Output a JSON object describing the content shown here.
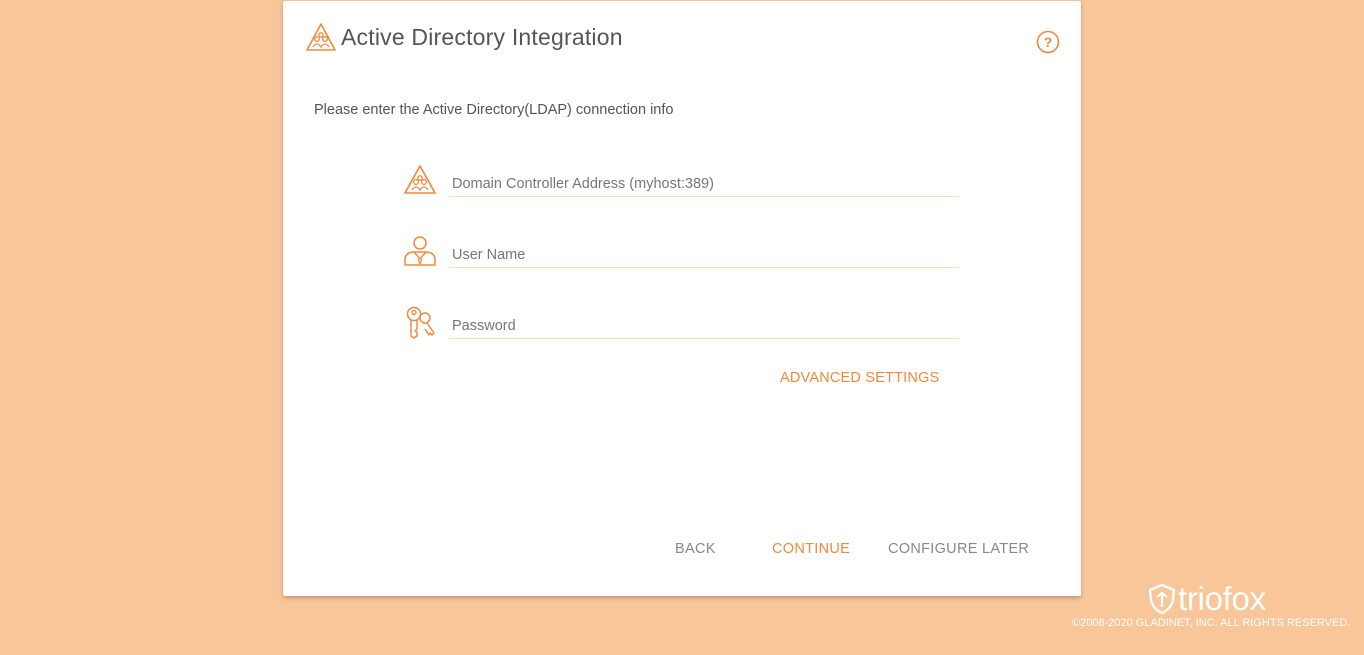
{
  "dialog": {
    "title": "Active Directory Integration",
    "intro": "Please enter the Active Directory(LDAP) connection info"
  },
  "fields": {
    "domain_controller": {
      "value": "",
      "placeholder": "Domain Controller Address (myhost:389)",
      "icon": "directory-icon"
    },
    "username": {
      "value": "",
      "placeholder": "User Name",
      "icon": "user-icon"
    },
    "password": {
      "value": "",
      "placeholder": "Password",
      "icon": "keys-icon"
    }
  },
  "links": {
    "advanced_settings": "ADVANCED SETTINGS"
  },
  "buttons": {
    "back": "BACK",
    "continue": "CONTINUE",
    "configure_later": "CONFIGURE LATER"
  },
  "help": {
    "symbol": "?"
  },
  "footer": {
    "brand": "triofox",
    "copyright": "©2008-2020 GLADINET, INC. ALL RIGHTS RESERVED."
  },
  "colors": {
    "background": "#f9c69a",
    "accent": "#f0883a",
    "text": "#555555",
    "muted": "#888888"
  }
}
